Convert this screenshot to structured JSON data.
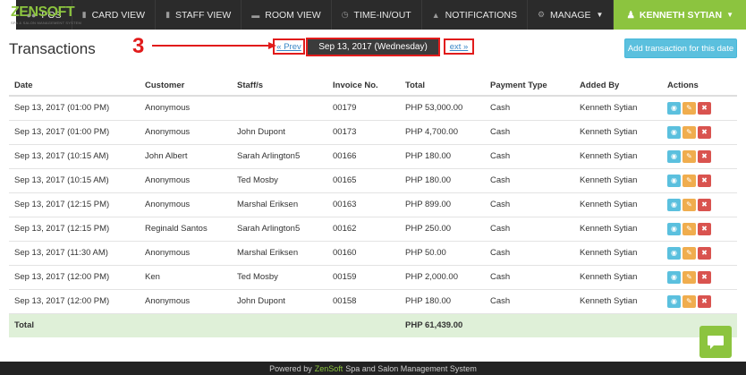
{
  "brand": {
    "logo": "ZENSOFT",
    "tagline": "SPA & SALON MANAGEMENT SYSTEM"
  },
  "nav": {
    "items": [
      {
        "label": "POS",
        "icon": "users-icon"
      },
      {
        "label": "CARD VIEW",
        "icon": "card-icon"
      },
      {
        "label": "STAFF VIEW",
        "icon": "staff-icon"
      },
      {
        "label": "ROOM VIEW",
        "icon": "bed-icon"
      },
      {
        "label": "TIME-IN/OUT",
        "icon": "clock-icon"
      },
      {
        "label": "NOTIFICATIONS",
        "icon": "bell-icon"
      },
      {
        "label": "MANAGE",
        "icon": "gear-icon"
      }
    ],
    "user": "KENNETH SYTIAN"
  },
  "page": {
    "title": "Transactions",
    "annotation_number": "3",
    "prev_label": "« Prev",
    "date_label": "Sep 13, 2017 (Wednesday)",
    "next_label": "ext »",
    "add_button": "Add transaction for this date"
  },
  "table": {
    "headers": [
      "Date",
      "Customer",
      "Staff/s",
      "Invoice No.",
      "Total",
      "Payment Type",
      "Added By",
      "Actions"
    ],
    "rows": [
      [
        "Sep 13, 2017 (01:00 PM)",
        "Anonymous",
        "",
        "00179",
        "PHP 53,000.00",
        "Cash",
        "Kenneth Sytian"
      ],
      [
        "Sep 13, 2017 (01:00 PM)",
        "Anonymous",
        "John Dupont",
        "00173",
        "PHP 4,700.00",
        "Cash",
        "Kenneth Sytian"
      ],
      [
        "Sep 13, 2017 (10:15 AM)",
        "John Albert",
        "Sarah Arlington5",
        "00166",
        "PHP 180.00",
        "Cash",
        "Kenneth Sytian"
      ],
      [
        "Sep 13, 2017 (10:15 AM)",
        "Anonymous",
        "Ted Mosby",
        "00165",
        "PHP 180.00",
        "Cash",
        "Kenneth Sytian"
      ],
      [
        "Sep 13, 2017 (12:15 PM)",
        "Anonymous",
        "Marshal Eriksen",
        "00163",
        "PHP 899.00",
        "Cash",
        "Kenneth Sytian"
      ],
      [
        "Sep 13, 2017 (12:15 PM)",
        "Reginald Santos",
        "Sarah Arlington5",
        "00162",
        "PHP 250.00",
        "Cash",
        "Kenneth Sytian"
      ],
      [
        "Sep 13, 2017 (11:30 AM)",
        "Anonymous",
        "Marshal Eriksen",
        "00160",
        "PHP 50.00",
        "Cash",
        "Kenneth Sytian"
      ],
      [
        "Sep 13, 2017 (12:00 PM)",
        "Ken",
        "Ted Mosby",
        "00159",
        "PHP 2,000.00",
        "Cash",
        "Kenneth Sytian"
      ],
      [
        "Sep 13, 2017 (12:00 PM)",
        "Anonymous",
        "John Dupont",
        "00158",
        "PHP 180.00",
        "Cash",
        "Kenneth Sytian"
      ]
    ],
    "total_label": "Total",
    "total_value": "PHP 61,439.00"
  },
  "footer": {
    "prefix": "Powered by",
    "brand": "ZenSoft",
    "suffix": "Spa and Salon Management System"
  },
  "colors": {
    "brand_green": "#8cc43f",
    "navbar": "#2b2b2b",
    "info": "#5bc0de",
    "warning": "#f0ad4e",
    "danger": "#d9534f",
    "annotation_red": "#e11b1b",
    "total_row": "#dff0d8"
  }
}
